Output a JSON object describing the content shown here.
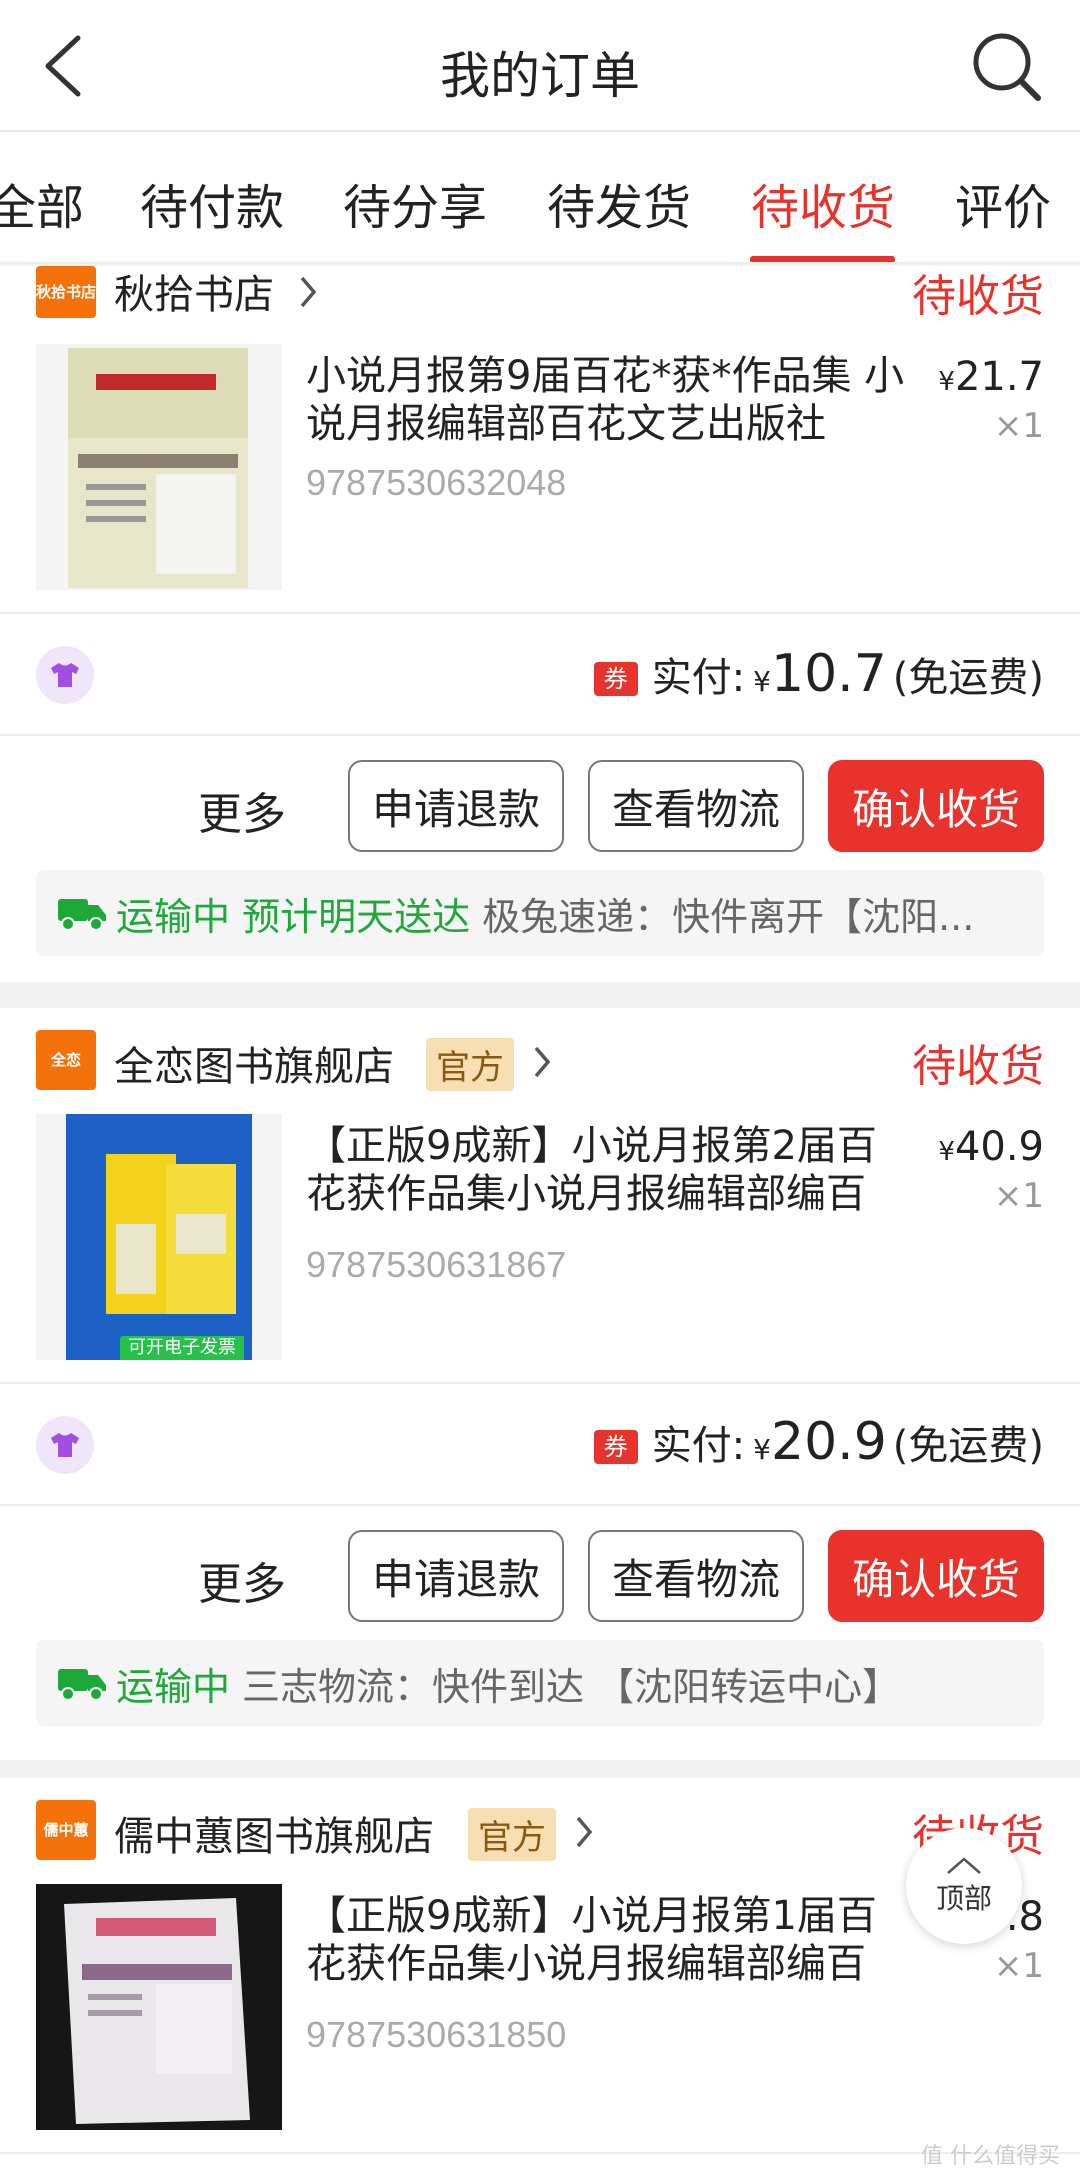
{
  "header": {
    "title": "我的订单"
  },
  "tabs": [
    {
      "label": "全部",
      "active": false
    },
    {
      "label": "待付款",
      "active": false
    },
    {
      "label": "待分享",
      "active": false
    },
    {
      "label": "待发货",
      "active": false
    },
    {
      "label": "待收货",
      "active": true
    },
    {
      "label": "评价",
      "active": false
    }
  ],
  "orders": [
    {
      "shop_logo_text": "秋拾书店",
      "shop_name": "秋拾书店",
      "official": "",
      "status": "待收货",
      "item_title": "小说月报第9届百花*获*作品集 小说月报编辑部百花文艺出版社",
      "isbn": "9787530632048",
      "price": "21.7",
      "qty": "×1",
      "coupon": "券",
      "paid_label": "实付:",
      "paid_currency": "¥",
      "paid_amount": "10.7",
      "paid_note": "(免运费)",
      "more": "更多",
      "btn_refund": "申请退款",
      "btn_logistics": "查看物流",
      "btn_confirm": "确认收货",
      "logistics_status": "运输中 预计明天送达",
      "logistics_detail": "极兔速递：快件离开【沈阳..."
    },
    {
      "shop_logo_text": "全恋",
      "shop_name": "全恋图书旗舰店",
      "official": "官方",
      "status": "待收货",
      "item_title": "【正版9成新】小说月报第2届百花获作品集小说月报编辑部编百",
      "isbn": "9787530631867",
      "price": "40.9",
      "qty": "×1",
      "invoice_tag": "可开电子发票",
      "coupon": "券",
      "paid_label": "实付:",
      "paid_currency": "¥",
      "paid_amount": "20.9",
      "paid_note": "(免运费)",
      "more": "更多",
      "btn_refund": "申请退款",
      "btn_logistics": "查看物流",
      "btn_confirm": "确认收货",
      "logistics_status": "运输中",
      "logistics_detail": "三志物流：快件到达 【沈阳转运中心】"
    },
    {
      "shop_logo_text": "儒中蕙",
      "shop_name": "儒中蕙图书旗舰店",
      "official": "官方",
      "status": "待收货",
      "item_title": "【正版9成新】小说月报第1届百花获作品集小说月报编辑部编百",
      "isbn": "9787530631850",
      "price": ".8",
      "qty": "×1"
    }
  ],
  "top_button": "顶部",
  "watermark": "值 什么值得买",
  "colors": {
    "accent": "#e8322c",
    "green": "#1fa83a",
    "shop_logo": "#f5720a"
  }
}
